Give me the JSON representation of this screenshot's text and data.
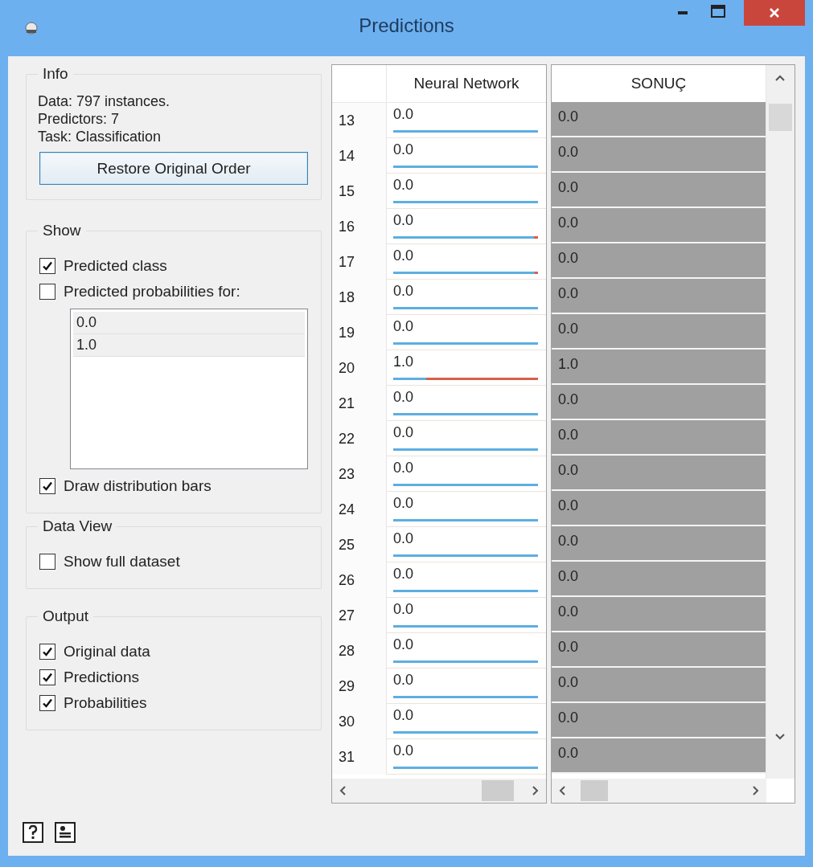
{
  "window": {
    "title": "Predictions"
  },
  "panels": [
    {
      "title": "Info",
      "items": [
        {
          "kind": "text",
          "text": "Data: 797 instances."
        },
        {
          "kind": "text",
          "text": "Predictors: 7"
        },
        {
          "kind": "text",
          "text": "Task: Classification"
        },
        {
          "kind": "button",
          "label": "Restore Original Order"
        }
      ]
    },
    {
      "title": "Show",
      "items": [
        {
          "kind": "checkbox",
          "label": "Predicted class",
          "checked": true
        },
        {
          "kind": "checkbox",
          "label": "Predicted probabilities for:",
          "checked": false
        },
        {
          "kind": "list",
          "entries": [
            {
              "label": "0.0",
              "selected": true
            },
            {
              "label": "1.0",
              "selected": true
            }
          ]
        },
        {
          "kind": "checkbox",
          "label": "Draw distribution bars",
          "checked": true
        }
      ]
    },
    {
      "title": "Data View",
      "items": [
        {
          "kind": "checkbox",
          "label": "Show full dataset",
          "checked": false
        }
      ]
    },
    {
      "title": "Output",
      "items": [
        {
          "kind": "checkbox",
          "label": "Original data",
          "checked": true
        },
        {
          "kind": "checkbox",
          "label": "Predictions",
          "checked": true
        },
        {
          "kind": "checkbox",
          "label": "Probabilities",
          "checked": true
        }
      ]
    }
  ],
  "table": {
    "columns": [
      "Neural Network",
      "SONUÇ"
    ],
    "rows": [
      {
        "index": "13",
        "prediction": "0.0",
        "level": 1,
        "actual": "0.0"
      },
      {
        "index": "14",
        "prediction": "0.0",
        "level": 1,
        "actual": "0.0"
      },
      {
        "index": "15",
        "prediction": "0.0",
        "level": 1,
        "actual": "0.0"
      },
      {
        "index": "16",
        "prediction": "0.0",
        "level": 0.97,
        "actual": "0.0"
      },
      {
        "index": "17",
        "prediction": "0.0",
        "level": 0.98,
        "actual": "0.0"
      },
      {
        "index": "18",
        "prediction": "0.0",
        "level": 1,
        "actual": "0.0"
      },
      {
        "index": "19",
        "prediction": "0.0",
        "level": 1,
        "actual": "0.0"
      },
      {
        "index": "20",
        "prediction": "1.0",
        "level": 0.23,
        "actual": "1.0"
      },
      {
        "index": "21",
        "prediction": "0.0",
        "level": 1,
        "actual": "0.0"
      },
      {
        "index": "22",
        "prediction": "0.0",
        "level": 1,
        "actual": "0.0"
      },
      {
        "index": "23",
        "prediction": "0.0",
        "level": 1,
        "actual": "0.0"
      },
      {
        "index": "24",
        "prediction": "0.0",
        "level": 1,
        "actual": "0.0"
      },
      {
        "index": "25",
        "prediction": "0.0",
        "level": 1,
        "actual": "0.0"
      },
      {
        "index": "26",
        "prediction": "0.0",
        "level": 1,
        "actual": "0.0"
      },
      {
        "index": "27",
        "prediction": "0.0",
        "level": 1,
        "actual": "0.0"
      },
      {
        "index": "28",
        "prediction": "0.0",
        "level": 1,
        "actual": "0.0"
      },
      {
        "index": "29",
        "prediction": "0.0",
        "level": 1,
        "actual": "0.0"
      },
      {
        "index": "30",
        "prediction": "0.0",
        "level": 1,
        "actual": "0.0"
      },
      {
        "index": "31",
        "prediction": "0.0",
        "level": 1,
        "actual": "0.0"
      }
    ]
  }
}
